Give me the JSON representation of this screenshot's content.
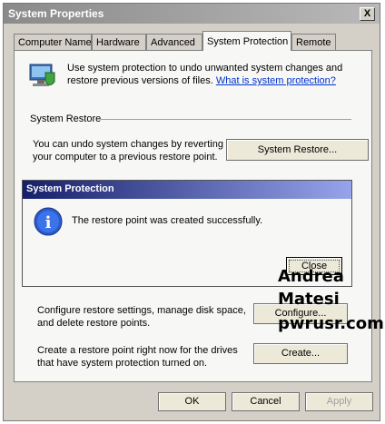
{
  "window": {
    "title": "System Properties",
    "close_glyph": "X"
  },
  "tabs": [
    "Computer Name",
    "Hardware",
    "Advanced",
    "System Protection",
    "Remote"
  ],
  "intro": {
    "text": "Use system protection to undo unwanted system changes and restore previous versions of files.",
    "link": "What is system protection?",
    "icon": "system-protection-icon"
  },
  "system_restore": {
    "heading": "System Restore",
    "text": "You can undo system changes by reverting your computer to a previous restore point.",
    "button": "System Restore..."
  },
  "dialog": {
    "title": "System Protection",
    "message": "The restore point was created successfully.",
    "close_button": "Close",
    "icon_glyph": "i",
    "icon": "info-icon"
  },
  "configure": {
    "text": "Configure restore settings, manage disk space, and delete restore points.",
    "button": "Configure..."
  },
  "create": {
    "text": "Create a restore point right now for the drives that have system protection turned on.",
    "button": "Create..."
  },
  "footer": {
    "ok": "OK",
    "cancel": "Cancel",
    "apply": "Apply"
  },
  "watermark": {
    "line1": "Andrea",
    "line2": "Matesi",
    "line3": "pwrusr.com"
  }
}
